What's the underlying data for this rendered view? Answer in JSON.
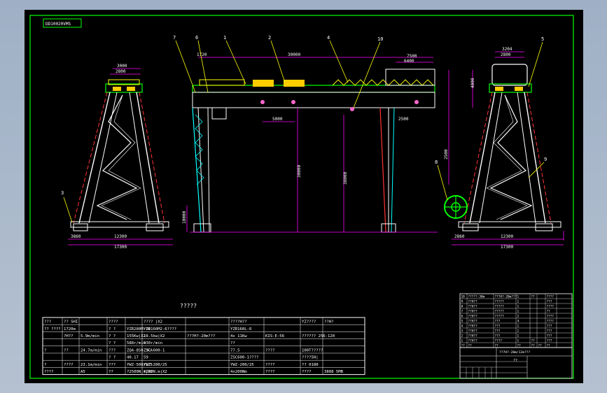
{
  "title_tag": "DD10020VMS",
  "section_heading": "?????",
  "callouts": [
    "7",
    "6",
    "1",
    "2",
    "4",
    "10",
    "3",
    "5",
    "8",
    "9"
  ],
  "dims": {
    "left_top1": "3000",
    "left_top2": "2800",
    "left_b1": "3860",
    "left_b2": "12300",
    "left_b3": "17300",
    "mid_top_left": "1720",
    "mid_span": "30000",
    "mid_right1": "7500",
    "mid_right2": "6400",
    "mid_trolley": "5000",
    "mid_trolley2": "2500",
    "mid_h1": "30000",
    "mid_h2": "38000",
    "mid_h3": "10000",
    "right_top1": "3204",
    "right_top2": "2800",
    "right_side1": "4000",
    "right_side2": "2500",
    "right_b1": "2860",
    "right_b2": "12300",
    "right_b3": "17300"
  },
  "spec_table": {
    "rows": [
      {
        "c1": "???",
        "c2": "?? SHI",
        "c3": "",
        "c4": "????",
        "c5": "",
        "c6": "???? |X2",
        "c7": "",
        "c8": "????H??",
        "c9": "",
        "c10": "YZ????",
        "c11": "??H?"
      },
      {
        "c1": "?? ????",
        "c2": "1720m",
        "c3": "",
        "c4": "? ?",
        "c5": "YZR280M-10",
        "c6": "YZR160M2-6????",
        "c7": "",
        "c8": "YZR160L-6",
        "c9": "",
        "c10": "",
        "c11": ""
      },
      {
        "c1": "",
        "c2": "?H??",
        "c3": "5.9m/min",
        "c4": "? ?",
        "c5": "155Kw|X2",
        "c6": "18.5kw|X2",
        "c7": "???H?-20m???",
        "c8": "4x 11Kw",
        "c9": "KIS-E-56",
        "c10": "?????? 256-120",
        "c11": ""
      },
      {
        "c1": "",
        "c2": "",
        "c3": "",
        "c4": "? ?",
        "c5": "588r/min",
        "c6": "930r/min",
        "c7": "",
        "c8": "??",
        "c9": "",
        "c10": "",
        "c11": ""
      },
      {
        "c1": "?",
        "c2": "??",
        "c3": "24.7m/min",
        "c4": "???",
        "c5": "ZQA-850-3CA",
        "c6": "ZSC-600-1",
        "c7": "",
        "c8": "77.5",
        "c9": "????",
        "c10": "100T?????",
        "c11": ""
      },
      {
        "c1": "",
        "c2": "",
        "c3": "",
        "c4": "? ?",
        "c5": "40.17",
        "c6": "59",
        "c7": "",
        "c8": "ZSC600-1????",
        "c9": "",
        "c10": "????5H|",
        "c11": ""
      },
      {
        "c1": "?",
        "c2": "????",
        "c3": "23.1m/min",
        "c4": "???",
        "c5": "YWZ-500/125",
        "c6": "YWZ-200/25",
        "c7": "",
        "c8": "YWZ-200/25",
        "c9": "????",
        "c10": "?? 0180",
        "c11": ""
      },
      {
        "c1": "????",
        "c2": "",
        "c3": "A5",
        "c4": "??",
        "c5": "?2500N.m|X2",
        "c6": "?200N.m|X2",
        "c7": "",
        "c8": "4x200Nm",
        "c9": "????",
        "c10": "????",
        "c11": "3808 5MB"
      }
    ]
  },
  "parts_table": {
    "rows": [
      [
        "10",
        "?????-30m",
        "???H?-20m???",
        "1",
        "??",
        "",
        "????",
        ""
      ],
      [
        "9",
        "??H??",
        "?????",
        "1",
        "",
        "",
        "???",
        ""
      ],
      [
        "8",
        "??H??",
        "?????",
        "1",
        "",
        "",
        "????",
        ""
      ],
      [
        "7",
        "??H??",
        "?????",
        "1",
        "",
        "",
        "??",
        ""
      ],
      [
        "6",
        "??H??",
        "?????",
        "2",
        "",
        "",
        "????",
        ""
      ],
      [
        "5",
        "??H??",
        "???",
        "4",
        "",
        "",
        "????",
        ""
      ],
      [
        "4",
        "??H??",
        "???",
        "1",
        "",
        "",
        "???",
        ""
      ],
      [
        "3",
        "??H??",
        "???",
        "1",
        "",
        "",
        "???",
        ""
      ],
      [
        "2",
        "??H??",
        "???",
        "1",
        "",
        "",
        "???",
        ""
      ],
      [
        "1",
        "??H??",
        "????",
        "1",
        "??",
        "",
        "???",
        ""
      ]
    ],
    "header": [
      "??",
      "??",
      "??",
      "??",
      "??",
      "??",
      "??",
      ""
    ],
    "title_block_name": "???H?-20m/12m???",
    "title_block_code": "??"
  }
}
